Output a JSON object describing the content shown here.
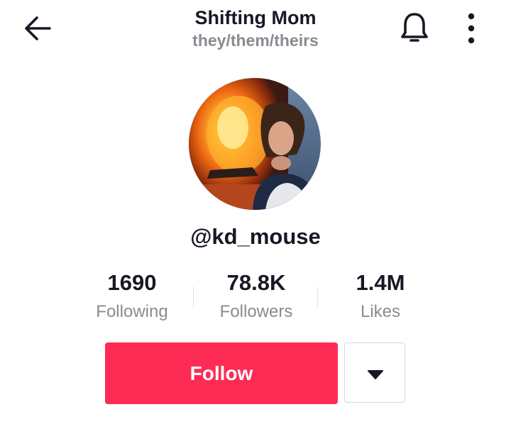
{
  "header": {
    "title": "Shifting Mom",
    "pronouns": "they/them/theirs",
    "back_icon": "arrow-left-icon",
    "bell_icon": "bell-icon",
    "more_icon": "more-vertical-icon"
  },
  "profile": {
    "username": "@kd_mouse"
  },
  "stats": {
    "following": {
      "value": "1690",
      "label": "Following"
    },
    "followers": {
      "value": "78.8K",
      "label": "Followers"
    },
    "likes": {
      "value": "1.4M",
      "label": "Likes"
    }
  },
  "actions": {
    "follow_label": "Follow",
    "dropdown_icon": "caret-down-icon"
  },
  "colors": {
    "accent": "#fe2c55",
    "text_primary": "#161823",
    "text_secondary": "#8a8b91"
  }
}
